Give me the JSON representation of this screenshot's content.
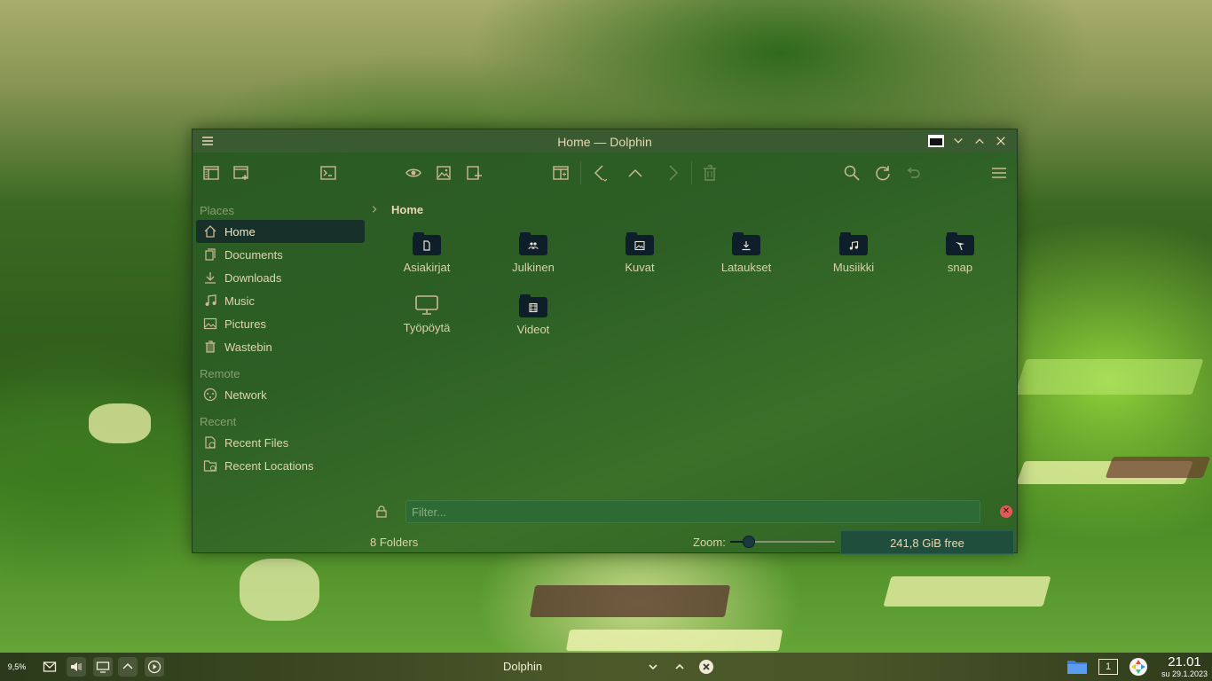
{
  "window": {
    "title": "Home — Dolphin"
  },
  "sidebar": {
    "sections": {
      "places": "Places",
      "remote": "Remote",
      "recent": "Recent"
    },
    "items": {
      "home": "Home",
      "documents": "Documents",
      "downloads": "Downloads",
      "music": "Music",
      "pictures": "Pictures",
      "wastebin": "Wastebin",
      "network": "Network",
      "recent_files": "Recent Files",
      "recent_locations": "Recent Locations"
    }
  },
  "breadcrumb": {
    "current": "Home"
  },
  "folders": {
    "f0": "Asiakirjat",
    "f1": "Julkinen",
    "f2": "Kuvat",
    "f3": "Lataukset",
    "f4": "Musiikki",
    "f5": "snap",
    "f6": "Työpöytä",
    "f7": "Videot"
  },
  "filter": {
    "placeholder": "Filter..."
  },
  "status": {
    "count": "8 Folders",
    "zoom_label": "Zoom:",
    "zoom_level": 0.18,
    "free_space": "241,8 GiB free"
  },
  "taskbar": {
    "cpu": "9,5%",
    "task_title": "Dolphin",
    "desktop_number": "1",
    "time": "21.01",
    "date": "su 29.1.2023"
  },
  "colors": {
    "accent": "#17312a",
    "folder": "#0f1e2b",
    "free_space_bg": "#1f4f3c",
    "clear_button": "#e05a5a"
  }
}
